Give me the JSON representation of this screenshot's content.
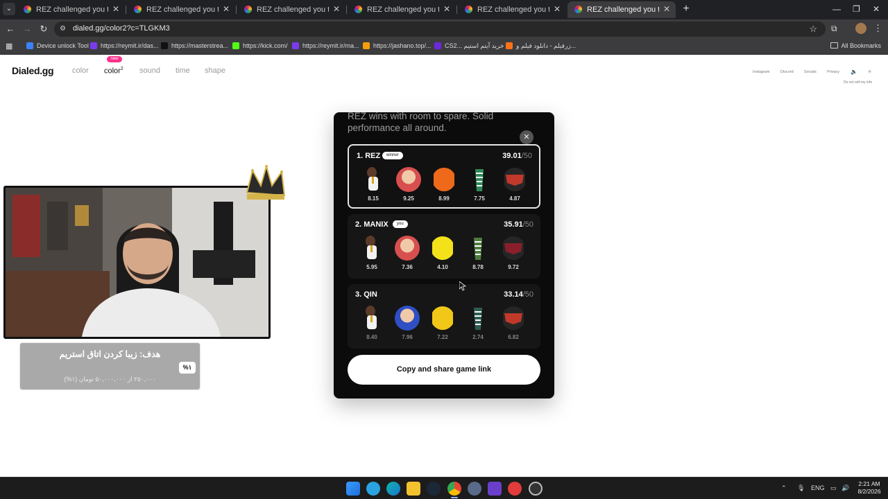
{
  "browser": {
    "tabs": [
      {
        "title": "REZ challenged you to a character"
      },
      {
        "title": "REZ challenged you to a character"
      },
      {
        "title": "REZ challenged you to a character"
      },
      {
        "title": "REZ challenged you to a character"
      },
      {
        "title": "REZ challenged you to a character"
      },
      {
        "title": "REZ challenged you to a character"
      }
    ],
    "url": "dialed.gg/color2?c=TLGKM3",
    "bookmarks": [
      {
        "label": "Device unlock Tool",
        "color": "#3b82f6"
      },
      {
        "label": "https://reymit.ir/das...",
        "color": "#7c3aed"
      },
      {
        "label": "https://masterstrea...",
        "color": "#111111"
      },
      {
        "label": "https://kick.com/",
        "color": "#53fc18"
      },
      {
        "label": "https://reymit.ir/ma...",
        "color": "#7c3aed"
      },
      {
        "label": "https://jashano.top/...",
        "color": "#f59e0b"
      },
      {
        "label": "CS2... خرید آیتم استیم",
        "color": "#6d28d9"
      },
      {
        "label": "زرفیلم - دانلود فیلم و...",
        "color": "#f97316"
      }
    ],
    "all_bookmarks": "All Bookmarks"
  },
  "site": {
    "logo": "Dialed.gg",
    "nav": [
      {
        "label": "color",
        "active": false
      },
      {
        "label": "color",
        "sup": "2",
        "active": true,
        "badge": "new"
      },
      {
        "label": "sound",
        "active": false
      },
      {
        "label": "time",
        "active": false
      },
      {
        "label": "shape",
        "active": false
      }
    ],
    "top_links": [
      "Instagram",
      "Discord",
      "Socials",
      "Privacy"
    ],
    "do_not_sell": "Do not sell my info"
  },
  "modal": {
    "summary": "REZ wins with room to spare. Solid performance all around.",
    "players": [
      {
        "rank": "1.",
        "name": "REZ",
        "badge": "winner",
        "score": "39.01",
        "max": "/50",
        "colors": [
          "#f2f2f2",
          "#d84f4f",
          "#ee6a1a",
          "#2e8b57",
          "#c0392b"
        ],
        "values": [
          "8.15",
          "9.25",
          "8.99",
          "7.75",
          "4.87"
        ]
      },
      {
        "rank": "2.",
        "name": "MANIX",
        "badge": "you",
        "score": "35.91",
        "max": "/50",
        "colors": [
          "#f2f2f2",
          "#d84f4f",
          "#f3e21a",
          "#4f7d3f",
          "#8a1f2b"
        ],
        "values": [
          "5.95",
          "7.36",
          "4.10",
          "8.78",
          "9.72"
        ]
      },
      {
        "rank": "3.",
        "name": "QIN",
        "badge": "",
        "score": "33.14",
        "max": "/50",
        "colors": [
          "#f2f2f2",
          "#2f4fc4",
          "#f2c818",
          "#2e5d52",
          "#c0392b"
        ],
        "values": [
          "8.40",
          "7.96",
          "7.22",
          "2.74",
          "6.82"
        ]
      }
    ],
    "share_label": "Copy and share game link"
  },
  "overlay": {
    "goal_title": "هدف: زیبا کردن اتاق استریم",
    "goal_sub": "۲۵۰,۰۰۰ از ۵۰,۰۰۰,۰۰۰ تومان (۱%)",
    "goal_pct": "%۱"
  },
  "taskbar": {
    "lang": "ENG",
    "time": "2:21 AM",
    "date": "8/2/2026"
  }
}
